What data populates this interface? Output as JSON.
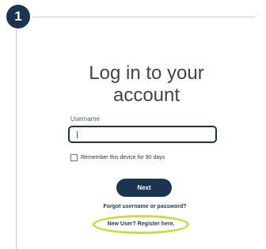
{
  "step": {
    "number": "1"
  },
  "login": {
    "title_line1": "Log in to your",
    "title_line2": "account",
    "username_label": "Username",
    "username_value": "",
    "remember_label": "Remember this device for 90 days",
    "remember_checked": false,
    "next_label": "Next",
    "forgot_link": "Forgot username or password?",
    "register_link": "New User? Register here."
  },
  "colors": {
    "primary": "#1b3551",
    "highlight": "#c8dc3c",
    "title_text": "#444444"
  }
}
